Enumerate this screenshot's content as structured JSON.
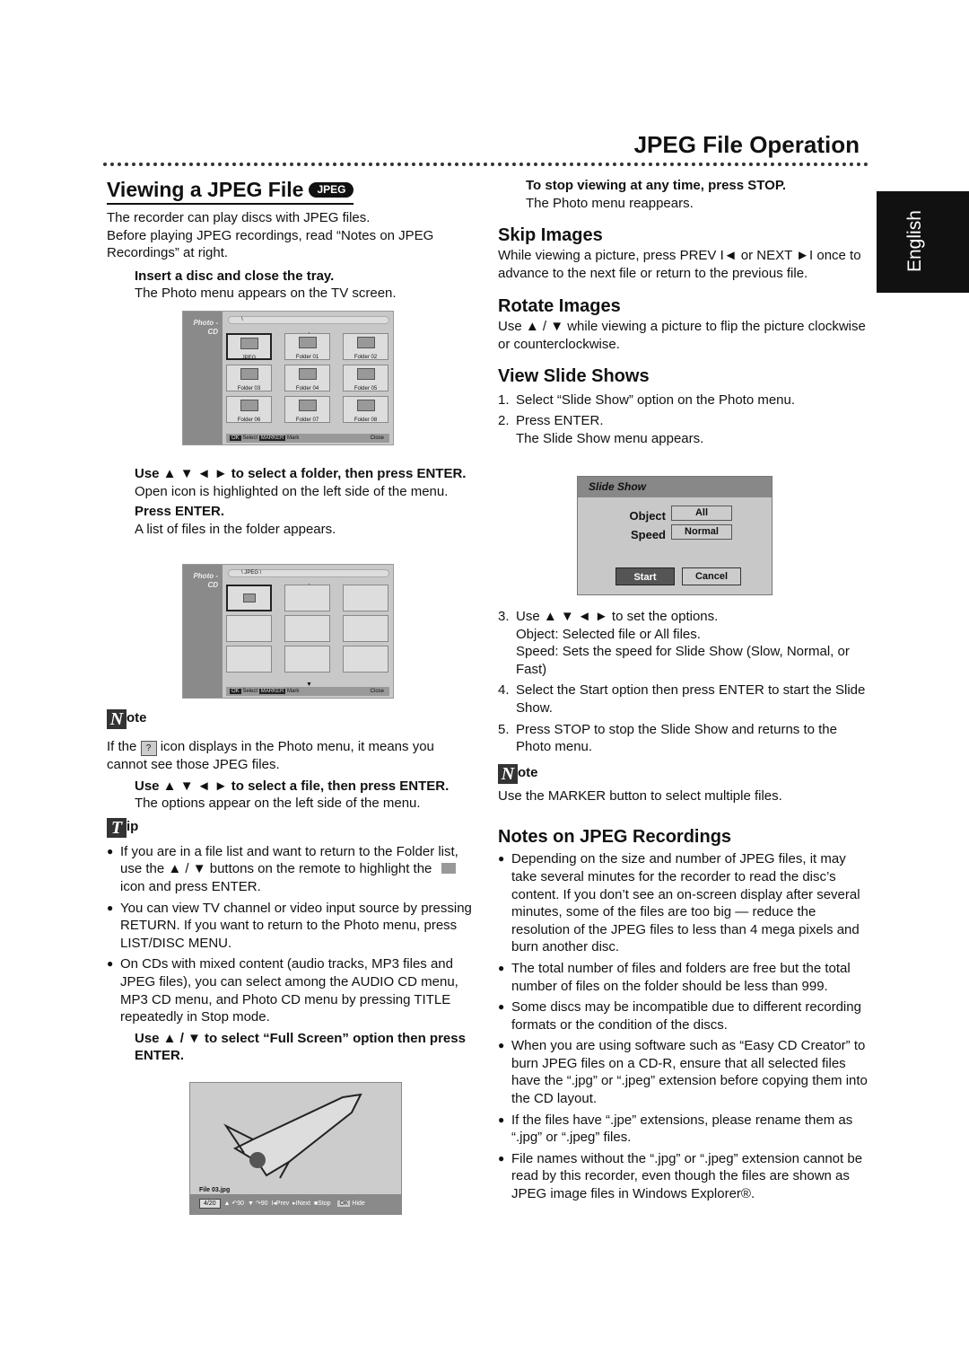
{
  "header": {
    "title": "JPEG File Operation",
    "lang_tab": "English"
  },
  "left": {
    "title": "Viewing a JPEG File",
    "badge": "JPEG",
    "intro": [
      "The recorder can play discs with JPEG files.",
      "Before playing JPEG recordings, read “Notes on JPEG Recordings” at right."
    ],
    "step1": {
      "bold": "Insert a disc and close the tray.",
      "text": "The Photo menu appears on the TV screen."
    },
    "step2": {
      "bold": "Use ▲ ▼ ◄ ► to select a folder, then press ENTER.",
      "text": "Open icon is highlighted on the left side of the menu."
    },
    "step3": {
      "bold": "Press ENTER.",
      "text": "A list of files in the folder appears."
    },
    "note": {
      "label": "ote",
      "pre": "If the",
      "icon": "?",
      "post": "icon displays in the Photo menu, it means you cannot see those JPEG files."
    },
    "step4": {
      "bold": "Use ▲ ▼ ◄ ► to select a file, then press ENTER.",
      "text": "The options appear on the left side of the menu."
    },
    "tip": {
      "label": "ip",
      "bullets": [
        "If you are in a file list and want to return to the Folder list, use the ▲ / ▼ buttons on the remote to highlight the",
        "icon and press ENTER.",
        "You can view TV channel or video input source by pressing RETURN. If you want to return to the Photo menu, press LIST/DISC MENU.",
        "On CDs with mixed content (audio tracks, MP3 files and JPEG files), you can select among the AUDIO CD menu, MP3 CD menu, and Photo CD menu by pressing TITLE repeatedly in Stop mode."
      ]
    },
    "step5": {
      "bold": "Use ▲ / ▼ to select “Full Screen” option then press ENTER."
    }
  },
  "menu1": {
    "side": "Photo -CD",
    "path": "\\",
    "folders": [
      "JPEG",
      "Folder 01",
      "Folder 02",
      "Folder 03",
      "Folder 04",
      "Folder 05",
      "Folder 06",
      "Folder 07",
      "Folder 08"
    ],
    "ok": "OK",
    "select": "Select",
    "marker": "MARKER",
    "mark": "Mark",
    "close": "Close"
  },
  "menu2": {
    "side": "Photo -CD",
    "path": "\\ JPEG \\",
    "ok": "OK",
    "select": "Select",
    "marker": "MARKER",
    "mark": "Mark",
    "close": "Close"
  },
  "viewer": {
    "file": "File 03.jpg",
    "counter": "4/20",
    "rot_cw": "90",
    "rot_ccw": "90",
    "prev": "Prev",
    "next": "Next",
    "stop": "Stop",
    "ok": "OK",
    "hide": "Hide"
  },
  "right": {
    "stop": {
      "bold": "To stop viewing at any time, press STOP.",
      "text": "The Photo menu reappears."
    },
    "skip": {
      "title": "Skip Images",
      "text": "While viewing a picture, press PREV I◄ or NEXT ►I once to advance to the next file or return to the previous file."
    },
    "rotate": {
      "title": "Rotate Images",
      "text": "Use ▲ / ▼ while viewing a picture to flip the picture clockwise or counterclockwise."
    },
    "slide": {
      "title": "View Slide Shows",
      "steps": [
        {
          "n": "1.",
          "t": "Select “Slide Show” option on the Photo menu."
        },
        {
          "n": "2.",
          "t": "Press ENTER.",
          "sub": "The Slide Show menu appears."
        }
      ],
      "steps2": [
        {
          "n": "3.",
          "t": "Use ▲ ▼ ◄ ► to set the options.",
          "sub": "Object: Selected file or All files.",
          "sub2": "Speed: Sets the speed for Slide Show (Slow, Normal, or Fast)"
        },
        {
          "n": "4.",
          "t": "Select the Start option then press ENTER to start the Slide Show."
        },
        {
          "n": "5.",
          "t": "Press STOP to stop the Slide Show and returns to the Photo menu."
        }
      ]
    },
    "note": {
      "label": "ote",
      "text": "Use the MARKER button to select multiple files."
    },
    "notes": {
      "title": "Notes on JPEG Recordings",
      "bullets": [
        "Depending on the size and number of JPEG files, it may take several minutes for the recorder to read the disc’s content. If you don’t see an on-screen display after several minutes, some of the files are too big — reduce the resolution of the JPEG files to less than 4 mega pixels and burn another disc.",
        "The total number of files and folders are free but the total number of files on the folder should be less than 999.",
        "Some discs may be incompatible due to different recording formats or the condition of the discs.",
        "When you are using software such as “Easy CD Creator” to burn JPEG files on a CD-R, ensure that all selected files have the “.jpg” or “.jpeg” extension before copying them into the CD layout.",
        "If the files have “.jpe” extensions, please rename them as “.jpg” or “.jpeg” files.",
        "File names without the “.jpg” or “.jpeg” extension cannot be read by this recorder, even though the files are shown as JPEG image files in Windows Explorer®."
      ]
    }
  },
  "slideshow": {
    "title": "Slide Show",
    "object_label": "Object",
    "object_value": "All",
    "speed_label": "Speed",
    "speed_value": "Normal",
    "start": "Start",
    "cancel": "Cancel"
  }
}
